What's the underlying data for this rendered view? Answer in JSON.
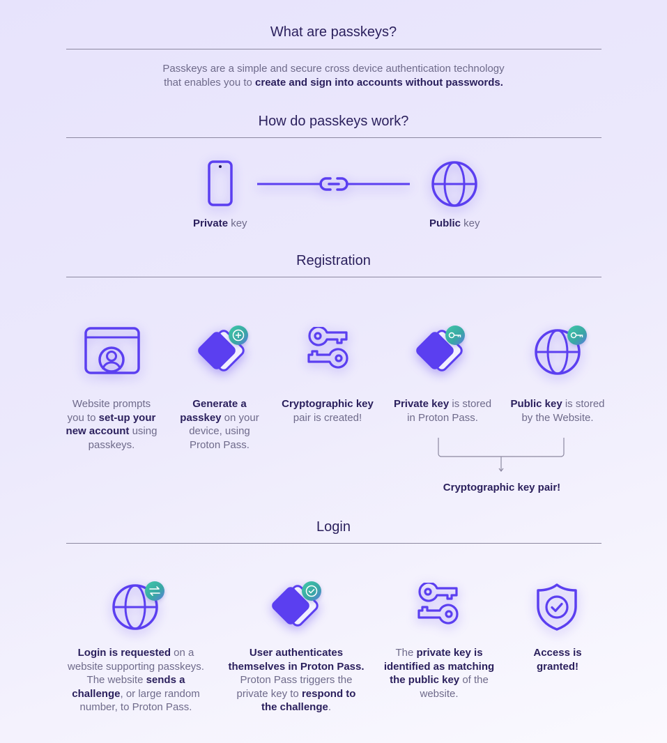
{
  "sections": {
    "what": {
      "title": "What are passkeys?",
      "intro_line1": "Passkeys are a simple and secure cross device authentication technology",
      "intro_line2_plain": "that enables you to ",
      "intro_line2_bold": "create and sign into accounts without passwords."
    },
    "how": {
      "title": "How do passkeys work?",
      "private_bold": "Private",
      "private_rest": " key",
      "public_bold": "Public",
      "public_rest": " key"
    },
    "registration": {
      "title": "Registration",
      "steps": [
        {
          "icon": "browser-user-icon",
          "parts": [
            {
              "t": "Website prompts",
              "b": false
            },
            {
              "t": "you to ",
              "b": false
            },
            {
              "t": "set-up your",
              "b": true
            },
            {
              "t": "new account",
              "b": true
            },
            {
              "t": " using",
              "b": false
            },
            {
              "t": "passkeys.",
              "b": false
            }
          ]
        },
        {
          "icon": "passkey-card-icon",
          "badge": "plus-icon",
          "parts": [
            {
              "t": "Generate a",
              "b": true
            },
            {
              "t": "passkey",
              "b": true
            },
            {
              "t": " on your",
              "b": false
            },
            {
              "t": "device, using",
              "b": false
            },
            {
              "t": "Proton Pass.",
              "b": false
            }
          ]
        },
        {
          "icon": "key-pair-icon",
          "parts": [
            {
              "t": "Cryptographic key",
              "b": true
            },
            {
              "t": "pair is created!",
              "b": false
            }
          ]
        },
        {
          "icon": "passkey-card-icon",
          "badge": "key-icon",
          "parts": [
            {
              "t": "Private key",
              "b": true
            },
            {
              "t": " is stored",
              "b": false
            },
            {
              "t": "in Proton Pass.",
              "b": false
            }
          ]
        },
        {
          "icon": "globe-icon",
          "badge": "key-icon",
          "parts": [
            {
              "t": "Public key",
              "b": true
            },
            {
              "t": " is stored",
              "b": false
            },
            {
              "t": "by the Website.",
              "b": false
            }
          ]
        }
      ],
      "bracket_label": "Cryptographic key pair!"
    },
    "login": {
      "title": "Login",
      "steps": [
        {
          "icon": "globe-icon",
          "badge": "swap-arrows-icon",
          "parts": [
            {
              "t": "Login is requested",
              "b": true
            },
            {
              "t": " on a",
              "b": false
            },
            {
              "t": "website supporting passkeys.",
              "b": false
            },
            {
              "t": "The website ",
              "b": false
            },
            {
              "t": "sends a",
              "b": true
            },
            {
              "t": "challenge",
              "b": true
            },
            {
              "t": ", or large random",
              "b": false
            },
            {
              "t": "number, to Proton Pass.",
              "b": false
            }
          ]
        },
        {
          "icon": "passkey-card-icon",
          "badge": "check-circle-icon",
          "parts": [
            {
              "t": "User authenticates",
              "b": true
            },
            {
              "t": "themselves in Proton Pass.",
              "b": true
            },
            {
              "t": "Proton Pass triggers the",
              "b": false
            },
            {
              "t": "private key to ",
              "b": false
            },
            {
              "t": "respond to",
              "b": true
            },
            {
              "t": "the challenge",
              "b": true
            },
            {
              "t": ".",
              "b": false
            }
          ]
        },
        {
          "icon": "key-pair-icon",
          "parts": [
            {
              "t": "The ",
              "b": false
            },
            {
              "t": "private key is",
              "b": true
            },
            {
              "t": "identified as matching",
              "b": true
            },
            {
              "t": "the public key",
              "b": true
            },
            {
              "t": " of the",
              "b": false
            },
            {
              "t": "website.",
              "b": false
            }
          ]
        },
        {
          "icon": "shield-check-icon",
          "parts": [
            {
              "t": "Access is",
              "b": true
            },
            {
              "t": "granted!",
              "b": true
            }
          ]
        }
      ]
    }
  },
  "colors": {
    "accent": "#5b3ff0",
    "heading": "#2a1f5c",
    "body_text": "#6e6a8a",
    "badge_green": "#3fc9a6",
    "rule": "#8c88a0"
  }
}
